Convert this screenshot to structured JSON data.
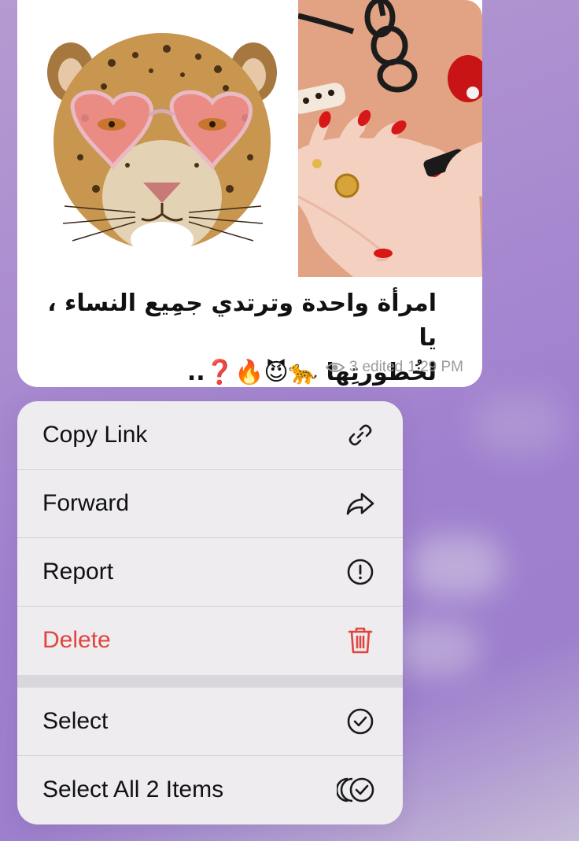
{
  "message": {
    "caption_line1": "امرأة واحدة وترتدي جمِيع النساء ، يا",
    "caption_line2": "لخُطورتِها 🐆😈🔥❓..",
    "views": "3",
    "edited_label": "edited",
    "time": "1:29 PM",
    "images": [
      {
        "icon": "leopard-heart-glasses-image"
      },
      {
        "icon": "red-nails-phone-cord-image"
      }
    ]
  },
  "context_menu": {
    "items": [
      {
        "label": "Copy Link",
        "icon": "link-icon"
      },
      {
        "label": "Forward",
        "icon": "forward-arrow-icon"
      },
      {
        "label": "Report",
        "icon": "exclamation-circle-icon"
      },
      {
        "label": "Delete",
        "icon": "trash-icon",
        "color": "#e0453e"
      },
      {
        "label": "Select",
        "icon": "checkmark-circle-icon"
      },
      {
        "label": "Select All 2 Items",
        "icon": "multi-checkmark-circle-icon"
      }
    ]
  },
  "colors": {
    "background": "#a98bd0",
    "bubble": "#ffffff",
    "menu": "#eeecef",
    "danger": "#e0453e",
    "meta_text": "#9a9aa0"
  }
}
